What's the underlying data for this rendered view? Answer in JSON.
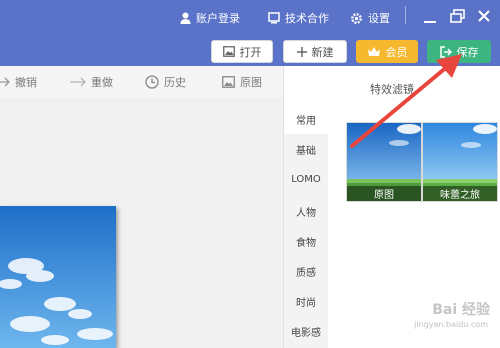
{
  "header": {
    "account_login": "账户登录",
    "tech_cooperation": "技术合作",
    "settings": "设置",
    "buttons": {
      "open": "打开",
      "new": "新建",
      "vip": "会员",
      "save": "保存"
    }
  },
  "toolbar": {
    "undo": "撤销",
    "redo": "重做",
    "history": "历史",
    "original": "原图"
  },
  "filters_panel": {
    "title": "特效滤镜",
    "categories": [
      "常用",
      "基础",
      "LOMO",
      "人物",
      "食物",
      "质感",
      "时尚",
      "电影感"
    ],
    "selected_category": "常用",
    "thumbnails": [
      {
        "label": "原图"
      },
      {
        "label": "味蕾之旅"
      }
    ]
  },
  "watermark": {
    "text": "Bai 经验",
    "url": "jingyan.baidu.com"
  },
  "colors": {
    "titlebar": "#5a73c9",
    "vip_button": "#f5b82e",
    "save_button": "#3cb581",
    "annotation_arrow": "#e8453c"
  }
}
